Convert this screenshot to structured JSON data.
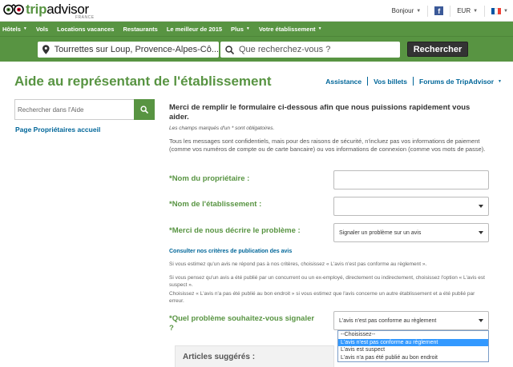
{
  "header": {
    "logo_word_trip": "trip",
    "logo_word_advisor": "advisor",
    "logo_sub": "FRANCE",
    "greeting": "Bonjour",
    "currency": "EUR",
    "facebook_glyph": "f"
  },
  "nav": {
    "items": [
      "Hôtels",
      "Vols",
      "Locations vacances",
      "Restaurants",
      "Le meilleur de 2015",
      "Plus",
      "Votre établissement"
    ],
    "has_caret": [
      true,
      false,
      false,
      false,
      false,
      true,
      true
    ]
  },
  "search": {
    "location": "Tourrettes sur Loup, Provence-Alpes-Cô...",
    "query_placeholder": "Que recherchez-vous ?",
    "button": "Rechercher"
  },
  "page": {
    "title": "Aide au représentant de l'établissement",
    "links": [
      "Assistance",
      "Vos billets",
      "Forums de TripAdvisor"
    ]
  },
  "sidebar": {
    "search_placeholder": "Rechercher dans l'Aide",
    "owner_link": "Page Propriétaires accueil"
  },
  "form": {
    "intro": "Merci de remplir le formulaire ci-dessous afin que nous puissions rapidement vous aider.",
    "required_note": "Les champs marqués d'un * sont obligatoires.",
    "privacy": "Tous les messages sont confidentiels, mais pour des raisons de sécurité, n'incluez pas vos informations de paiement (comme vos numéros de compte ou de carte bancaire) ou vos informations de connexion (comme vos mots de passe).",
    "owner_name_label": "*Nom du propriétaire :",
    "establishment_label": "*Nom de l'établissement :",
    "problem_label": "*Merci de nous décrire le problème :",
    "problem_value": "Signaler un problème sur un avis",
    "criteria_link": "Consulter nos critères de publication des avis",
    "info_1": "Si vous estimez qu'un avis ne répond pas à nos critères, choisissez « L'avis n'est pas conforme au règlement ».",
    "info_2": "Si vous pensez qu'un avis a été publié par un concurrent ou un ex-employé, directement ou indirectement, choisissez l'option « L'avis est suspect ».",
    "info_3": "Choisissez « L'avis n'a pas été publié au bon endroit » si vous estimez que l'avis concerne un autre établissement et a été publié par erreur.",
    "which_problem_label": "*Quel problème souhaitez-vous signaler ?",
    "which_problem_value": "L'avis n'est pas conforme au règlement",
    "dropdown_options": [
      "--Choisissez--",
      "L'avis n'est pas conforme au règlement",
      "L'avis est suspect",
      "L'avis n'a pas été publié au bon endroit"
    ],
    "dropdown_selected_index": 1
  },
  "articles": {
    "title": "Articles suggérés :"
  },
  "colors": {
    "brand_green": "#589442",
    "link_blue": "#006699",
    "highlight_blue": "#3399ff"
  }
}
